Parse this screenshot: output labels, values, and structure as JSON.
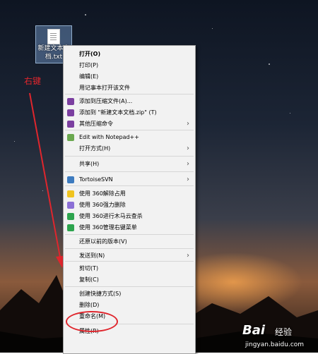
{
  "desktop": {
    "file_icon": {
      "name": "新建文本文档.txt",
      "icon": "text-file-icon"
    }
  },
  "annotation": {
    "text": "右键",
    "color": "#e0262d"
  },
  "context_menu": {
    "items": [
      {
        "label": "打开(O)",
        "bold": true,
        "icon": null,
        "submenu": false
      },
      {
        "label": "打印(P)",
        "icon": null,
        "submenu": false
      },
      {
        "label": "编辑(E)",
        "icon": null,
        "submenu": false
      },
      {
        "label": "用记事本打开该文件",
        "icon": null,
        "submenu": false
      },
      {
        "label": "添加到压缩文件(A)...",
        "icon": "winrar-icon",
        "submenu": false
      },
      {
        "label": "添加到 \"新建文本文档.zip\" (T)",
        "icon": "winrar-icon",
        "submenu": false
      },
      {
        "label": "其他压缩命令",
        "icon": "winrar-icon",
        "submenu": true
      },
      {
        "label": "Edit with Notepad++",
        "icon": "notepadpp-icon",
        "submenu": false
      },
      {
        "label": "打开方式(H)",
        "icon": null,
        "submenu": true
      },
      {
        "label": "共享(H)",
        "icon": null,
        "submenu": true
      },
      {
        "label": "TortoiseSVN",
        "icon": "tortoisesvn-icon",
        "submenu": true
      },
      {
        "label": "使用 360解除占用",
        "icon": "360-unlock-icon",
        "submenu": false
      },
      {
        "label": "使用 360强力删除",
        "icon": "360-delete-icon",
        "submenu": false
      },
      {
        "label": "使用 360进行木马云查杀",
        "icon": "360-scan-icon",
        "submenu": false
      },
      {
        "label": "使用 360管理右键菜单",
        "icon": "360-manage-icon",
        "submenu": false
      },
      {
        "label": "还原以前的版本(V)",
        "icon": null,
        "submenu": false
      },
      {
        "label": "发送到(N)",
        "icon": null,
        "submenu": true
      },
      {
        "label": "剪切(T)",
        "icon": null,
        "submenu": false
      },
      {
        "label": "复制(C)",
        "icon": null,
        "submenu": false
      },
      {
        "label": "创建快捷方式(S)",
        "icon": null,
        "submenu": false
      },
      {
        "label": "删除(D)",
        "icon": null,
        "submenu": false
      },
      {
        "label": "重命名(M)",
        "icon": null,
        "submenu": false,
        "highlighted": true
      },
      {
        "label": "属性(R)",
        "icon": null,
        "submenu": false
      }
    ]
  },
  "watermark": {
    "logo": "Bai 经验",
    "url": "jingyan.baidu.com"
  }
}
